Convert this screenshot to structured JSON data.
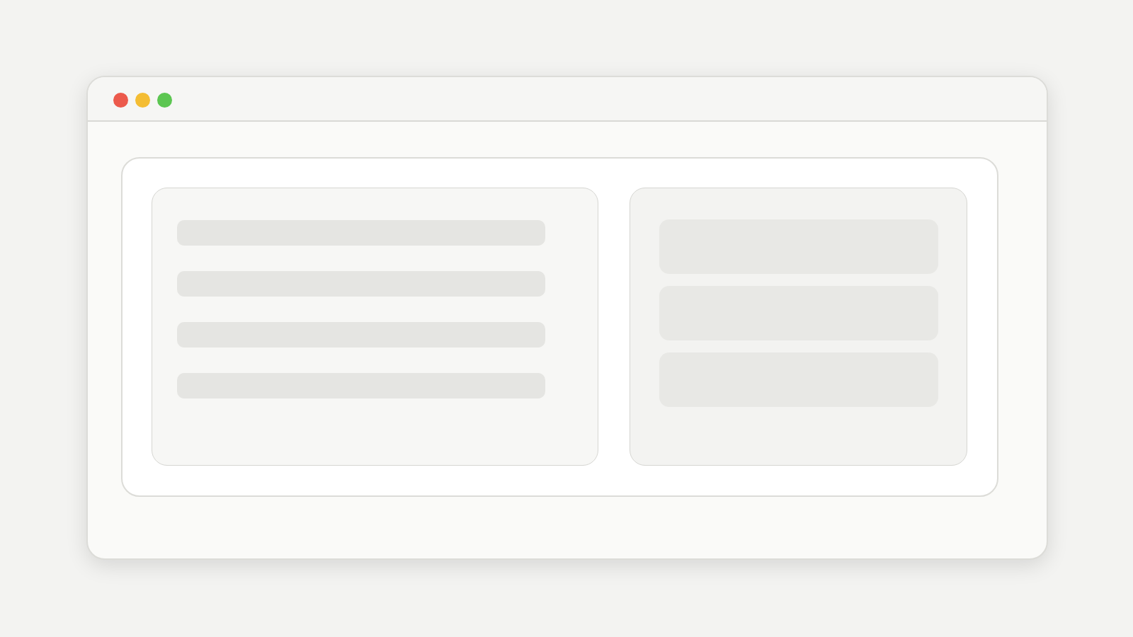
{
  "window": {
    "controls": [
      {
        "color": "#ec5a4c"
      },
      {
        "color": "#f4bd33"
      },
      {
        "color": "#5cc651"
      }
    ]
  },
  "left_panel": {
    "items": [
      {
        "kind": "line"
      },
      {
        "kind": "line"
      },
      {
        "kind": "line"
      },
      {
        "kind": "line"
      }
    ]
  },
  "right_panel": {
    "items": [
      {
        "kind": "block"
      },
      {
        "kind": "block"
      },
      {
        "kind": "block"
      }
    ]
  }
}
